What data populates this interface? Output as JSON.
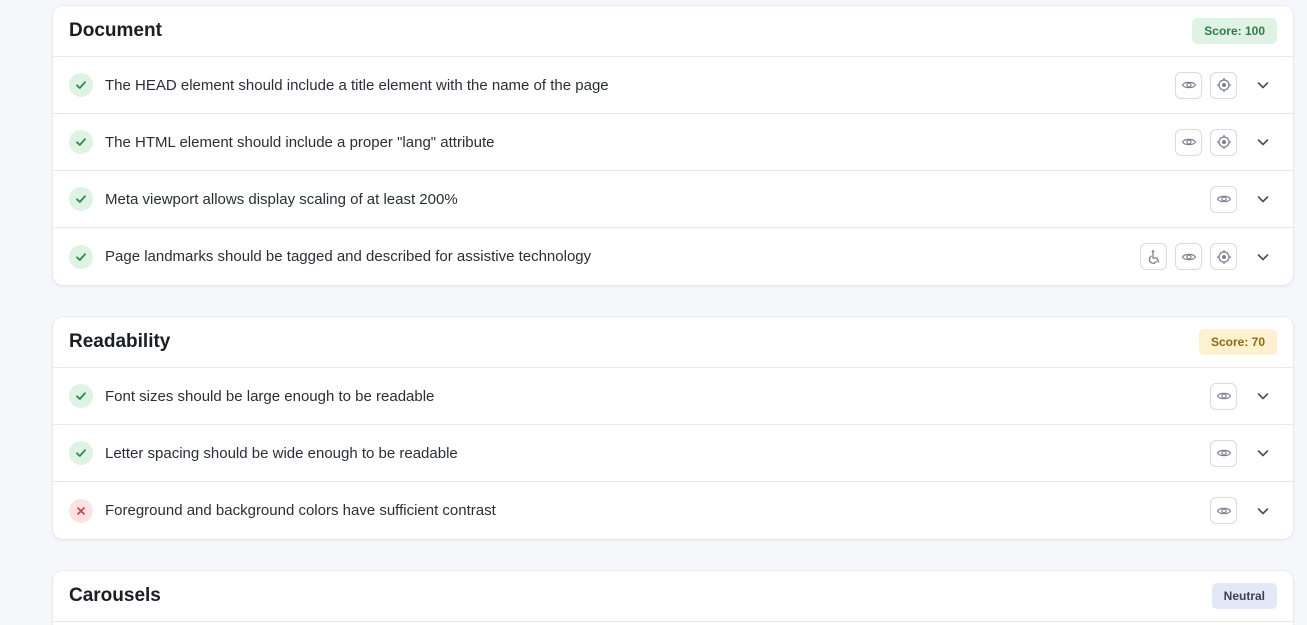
{
  "colors": {
    "pass_bg": "#dff3e4",
    "pass_fg": "#2e8b4a",
    "fail_bg": "#fde2e4",
    "fail_fg": "#d33a47",
    "score_green_bg": "#dff3e4",
    "score_green_fg": "#2e7d46",
    "score_yellow_bg": "#fdf1cf",
    "score_yellow_fg": "#8a6a14",
    "neutral_bg": "#e3e8f7",
    "neutral_fg": "#3a4256"
  },
  "sections": [
    {
      "title": "Document",
      "badge": "Score: 100",
      "rows": [
        {
          "status": "pass",
          "text": "The HEAD element should include a title element with the name of the page",
          "icons": [
            "eye-icon",
            "target-icon"
          ]
        },
        {
          "status": "pass",
          "text": "The HTML element should include a proper \"lang\" attribute",
          "icons": [
            "eye-icon",
            "target-icon"
          ]
        },
        {
          "status": "pass",
          "text": "Meta viewport allows display scaling of at least 200%",
          "icons": [
            "eye-icon"
          ]
        },
        {
          "status": "pass",
          "text": "Page landmarks should be tagged and described for assistive technology",
          "icons": [
            "accessibility-icon",
            "eye-icon",
            "target-icon"
          ]
        }
      ]
    },
    {
      "title": "Readability",
      "badge": "Score: 70",
      "rows": [
        {
          "status": "pass",
          "text": "Font sizes should be large enough to be readable",
          "icons": [
            "eye-icon"
          ]
        },
        {
          "status": "pass",
          "text": "Letter spacing should be wide enough to be readable",
          "icons": [
            "eye-icon"
          ]
        },
        {
          "status": "fail",
          "text": "Foreground and background colors have sufficient contrast",
          "icons": [
            "eye-icon"
          ]
        }
      ]
    },
    {
      "title": "Carousels",
      "badge": "Neutral",
      "rows": []
    }
  ]
}
